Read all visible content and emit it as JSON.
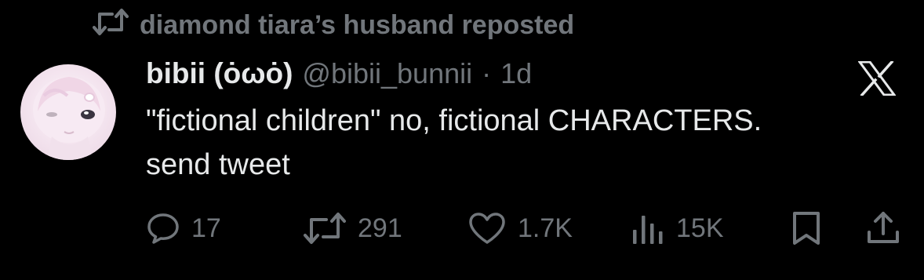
{
  "repost": {
    "text": "diamond tiara’s husband reposted",
    "icon": "repost-icon"
  },
  "tweet": {
    "display_name": "bibii (ȯωȯ)",
    "handle": "@bibii_bunnii",
    "separator": "·",
    "time": "1d",
    "text_lines": [
      "\"fictional children\" no, fictional CHARACTERS.",
      "send tweet"
    ],
    "avatar": "avatar"
  },
  "brand": {
    "logo": "x-logo-icon"
  },
  "actions": {
    "replies": "17",
    "reposts": "291",
    "likes": "1.7K",
    "views": "15K"
  },
  "colors": {
    "background": "#000000",
    "primary_text": "#e7e9ea",
    "secondary_text": "#71767b"
  }
}
